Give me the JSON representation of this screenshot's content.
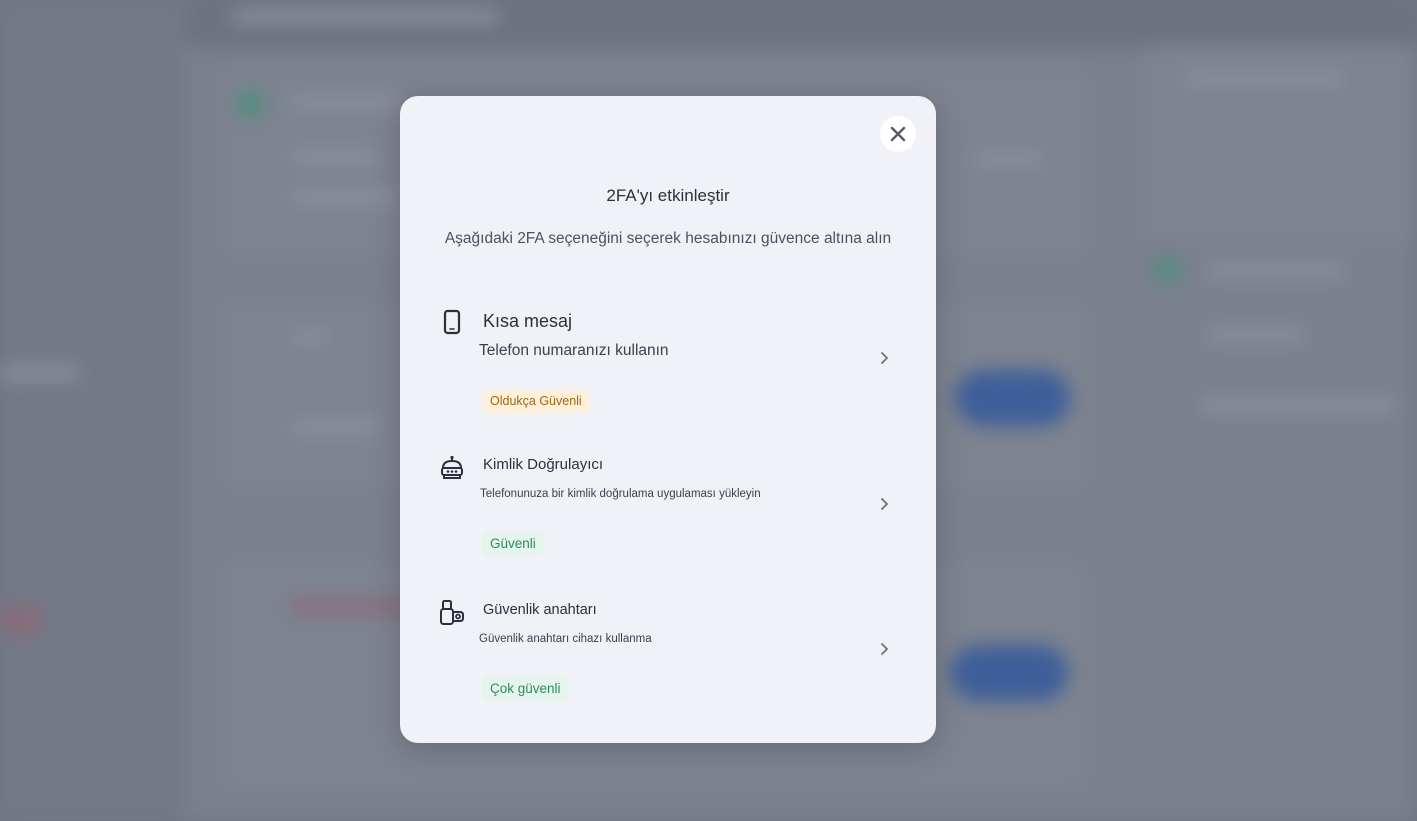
{
  "modal": {
    "title": "2FA'yı etkinleştir",
    "subtitle": "Aşağıdaki 2FA seçeneğini seçerek hesabınızı güvence altına alın",
    "close_icon": "close-icon",
    "options": [
      {
        "icon": "smartphone-icon",
        "title": "Kısa mesaj",
        "description": "Telefon numaranızı kullanın",
        "badge": "Oldukça Güvenli",
        "badge_color": "#a5670a"
      },
      {
        "icon": "authenticator-robot-icon",
        "title": "Kimlik Doğrulayıcı",
        "description": "Telefonunuza bir kimlik doğrulama uygulaması yükleyin",
        "badge": "Güvenli",
        "badge_color": "#2f8a63"
      },
      {
        "icon": "security-key-icon",
        "title": "Güvenlik anahtarı",
        "description": "Güvenlik anahtarı cihazı kullanma",
        "badge": "Çok güvenli",
        "badge_color": "#2f8a63"
      }
    ]
  },
  "colors": {
    "modal_background": "#f1f2f7",
    "overlay": "#6f7583",
    "text_primary": "#2b3040"
  }
}
